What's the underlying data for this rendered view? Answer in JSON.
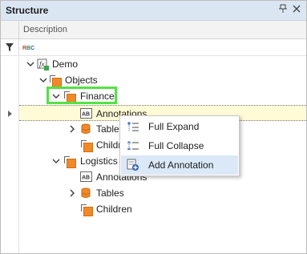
{
  "panel": {
    "title": "Structure"
  },
  "column_header": {
    "description": "Description"
  },
  "filter": {
    "text_badge": "RBC"
  },
  "tree": {
    "demo": "Demo",
    "objects": "Objects",
    "finance": "Finance",
    "finance_annotations": "Annotations",
    "finance_tables": "Tables",
    "finance_children": "Children",
    "logistics": "Logistics",
    "logistics_annotations": "Annotations",
    "logistics_tables": "Tables",
    "logistics_children": "Children"
  },
  "context_menu": {
    "items": [
      {
        "label": "Full Expand"
      },
      {
        "label": "Full Collapse"
      },
      {
        "label": "Add Annotation"
      }
    ]
  },
  "colors": {
    "titlebar": "#dbe6f3",
    "selection": "#fffbd6",
    "highlight": "#52e342",
    "node_orange": "#f0892a",
    "menu_hover": "#dbe8f7"
  },
  "icons": {
    "pin": "pin-icon",
    "close": "close-icon",
    "filter": "funnel-icon",
    "demo": "function-icon",
    "object": "orange-square-icon",
    "annotation": "ab-text-icon",
    "tables": "database-icon",
    "expand": "expand-tree-icon",
    "collapse": "collapse-tree-icon",
    "add": "add-annotation-icon"
  }
}
